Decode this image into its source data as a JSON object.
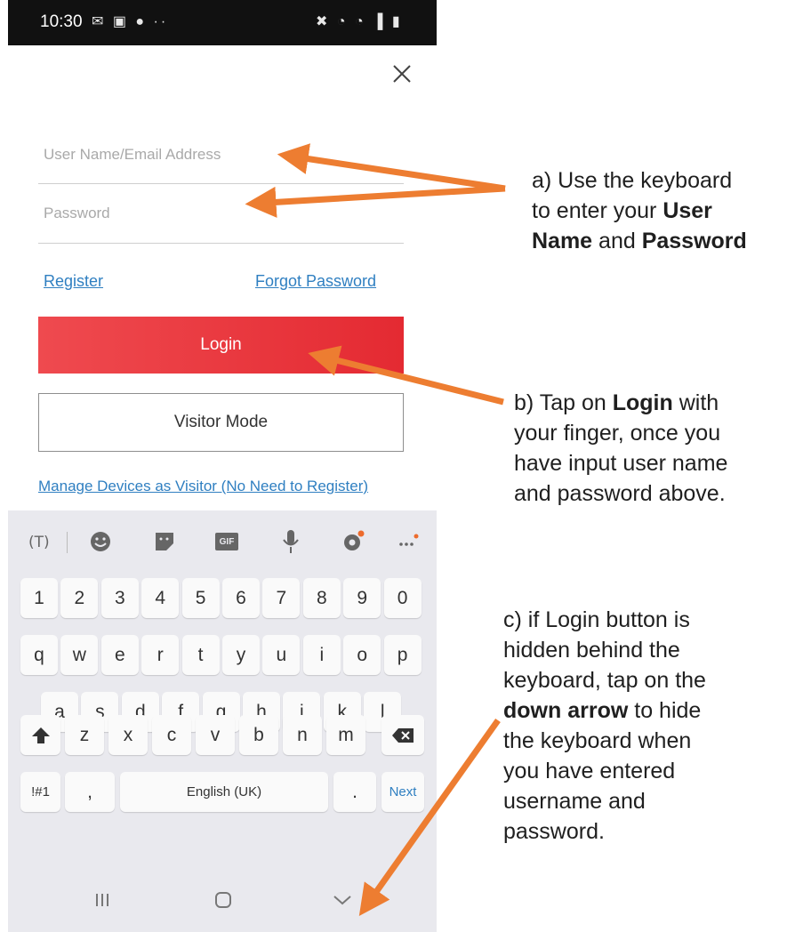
{
  "status_bar": {
    "time": "10:30",
    "left_icons": "✉ ▣ ● ··",
    "right_icons": "✖ ◔ ◔ ▐ ▮"
  },
  "form": {
    "username_placeholder": "User Name/Email Address",
    "password_placeholder": "Password",
    "register_label": "Register",
    "forgot_label": "Forgot Password",
    "login_label": "Login",
    "visitor_label": "Visitor Mode",
    "manage_label": "Manage Devices as Visitor (No Need to Register)"
  },
  "keyboard": {
    "toolbar_icons": [
      "text-tool-icon",
      "emoji-icon",
      "sticker-icon",
      "gif-icon",
      "microphone-icon",
      "settings-icon",
      "more-icon"
    ],
    "gif_label": "GIF",
    "number_row": [
      "1",
      "2",
      "3",
      "4",
      "5",
      "6",
      "7",
      "8",
      "9",
      "0"
    ],
    "row_q": [
      "q",
      "w",
      "e",
      "r",
      "t",
      "y",
      "u",
      "i",
      "o",
      "p"
    ],
    "row_a": [
      "a",
      "s",
      "d",
      "f",
      "g",
      "h",
      "j",
      "k",
      "l"
    ],
    "row_z": [
      "z",
      "x",
      "c",
      "v",
      "b",
      "n",
      "m"
    ],
    "symbols_label": "!#1",
    "comma_label": ",",
    "space_label": "English (UK)",
    "period_label": ".",
    "next_label": "Next"
  },
  "nav_bar": {
    "icons": [
      "recent-apps-icon",
      "home-icon",
      "hide-keyboard-icon"
    ]
  },
  "annotations": {
    "a": {
      "line1": "a) Use the keyboard",
      "line2_pre": "to enter your ",
      "line2_bold": "User",
      "line3_bold1": "Name",
      "line3_mid": " and ",
      "line3_bold2": "Password"
    },
    "b": {
      "line1_pre": "b) Tap on ",
      "line1_bold": "Login",
      "line1_post": " with",
      "line2": "your finger, once you",
      "line3": "have input user name",
      "line4": "and password above."
    },
    "c": {
      "line1": "c) if Login button is",
      "line2": "hidden behind the",
      "line3": "keyboard, tap on the",
      "line4_bold": "down arrow",
      "line4_post": " to hide",
      "line5": "the keyboard when",
      "line6": "you have entered",
      "line7": "username and",
      "line8": "password."
    }
  },
  "colors": {
    "login_red": "#e8333a",
    "link_blue": "#2f7fc1",
    "arrow_orange": "#ed7d31",
    "keyboard_bg": "#e9e9ee"
  }
}
